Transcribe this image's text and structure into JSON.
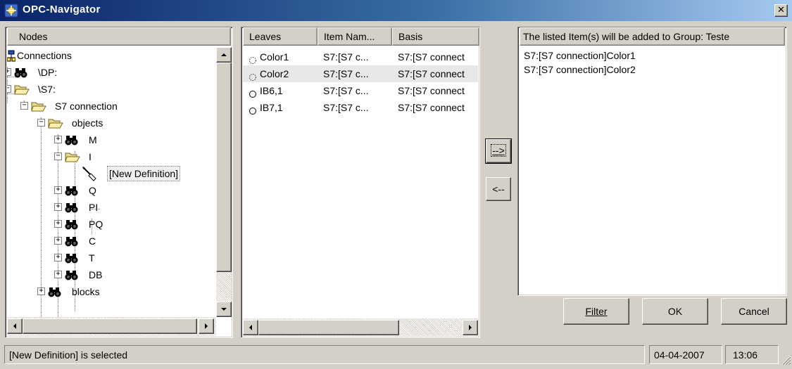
{
  "window": {
    "title": "OPC-Navigator",
    "close_glyph": "✕"
  },
  "tree_panel": {
    "header": "Nodes",
    "nodes": [
      {
        "label": "Connections",
        "icon": "network-icon",
        "expander": ""
      },
      {
        "label": "\\DP:",
        "icon": "binoculars-icon",
        "expander": "+"
      },
      {
        "label": "\\S7:",
        "icon": "folder-open-icon",
        "expander": "-"
      },
      {
        "label": "S7 connection",
        "icon": "folder-open-icon",
        "expander": "-"
      },
      {
        "label": "objects",
        "icon": "folder-open-icon",
        "expander": "-"
      },
      {
        "label": "M",
        "icon": "binoculars-icon",
        "expander": "+"
      },
      {
        "label": "I",
        "icon": "folder-open-icon",
        "expander": "-"
      },
      {
        "label": "[New Definition]",
        "icon": "new-definition-icon",
        "expander": ""
      },
      {
        "label": "Q",
        "icon": "binoculars-icon",
        "expander": "+"
      },
      {
        "label": "PI",
        "icon": "binoculars-icon",
        "expander": "+"
      },
      {
        "label": "PQ",
        "icon": "binoculars-icon",
        "expander": "+"
      },
      {
        "label": "C",
        "icon": "binoculars-icon",
        "expander": "+"
      },
      {
        "label": "T",
        "icon": "binoculars-icon",
        "expander": "+"
      },
      {
        "label": "DB",
        "icon": "binoculars-icon",
        "expander": "+"
      },
      {
        "label": "blocks",
        "icon": "binoculars-icon",
        "expander": "+"
      }
    ],
    "selected": "[New Definition]"
  },
  "leaves_panel": {
    "columns": [
      "Leaves",
      "Item Nam...",
      "Basis"
    ],
    "rows": [
      {
        "leaf": "Color1",
        "item_name": "S7:[S7 c...",
        "basis": "S7:[S7 connect",
        "icon": "dotted-circle-icon"
      },
      {
        "leaf": "Color2",
        "item_name": "S7:[S7 c...",
        "basis": "S7:[S7 connect",
        "icon": "dotted-circle-icon"
      },
      {
        "leaf": "IB6,1",
        "item_name": "S7:[S7 c...",
        "basis": "S7:[S7 connect",
        "icon": "circle-icon"
      },
      {
        "leaf": "IB7,1",
        "item_name": "S7:[S7 c...",
        "basis": "S7:[S7 connect",
        "icon": "circle-icon"
      }
    ]
  },
  "transfer_buttons": {
    "add_label": "-->",
    "remove_label": "<--"
  },
  "group_panel": {
    "header": "The listed Item(s) will be added to Group: Teste",
    "items": [
      "S7:[S7 connection]Color1",
      "S7:[S7 connection]Color2"
    ]
  },
  "actions": {
    "filter_label": "Filter",
    "ok_label": "OK",
    "cancel_label": "Cancel"
  },
  "status_bar": {
    "message": "[New Definition] is selected",
    "date": "04-04-2007",
    "time": "13:06"
  }
}
